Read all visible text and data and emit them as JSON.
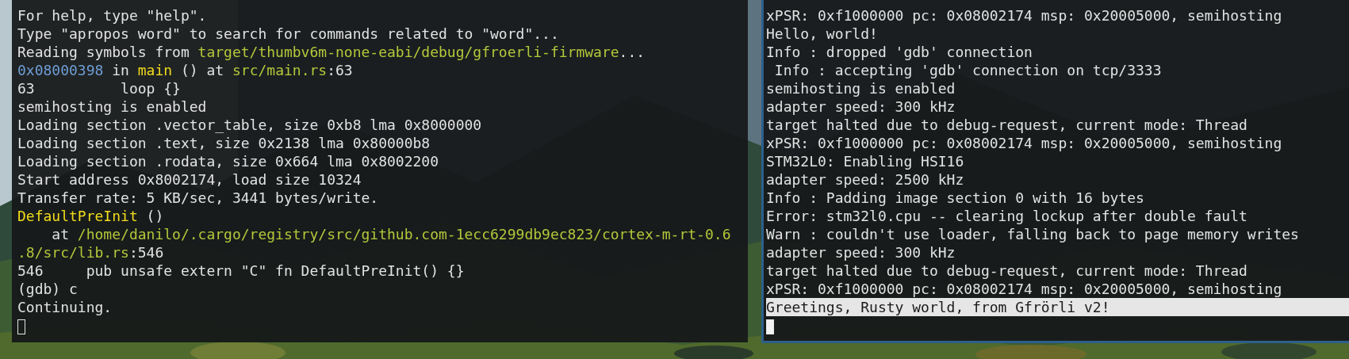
{
  "left_terminal": {
    "cursor_focused": false,
    "lines": [
      [
        {
          "kind": "plain",
          "text": "For help, type \"help\"."
        }
      ],
      [
        {
          "kind": "plain",
          "text": "Type \"apropos word\" to search for commands related to \"word\"..."
        }
      ],
      [
        {
          "kind": "plain",
          "text": "Reading symbols from "
        },
        {
          "kind": "path",
          "text": "target/thumbv6m-none-eabi/debug/gfroerli-firmware"
        },
        {
          "kind": "plain",
          "text": "..."
        }
      ],
      [
        {
          "kind": "address",
          "text": "0x08000398"
        },
        {
          "kind": "plain",
          "text": " in "
        },
        {
          "kind": "function",
          "text": "main"
        },
        {
          "kind": "plain",
          "text": " () at "
        },
        {
          "kind": "path",
          "text": "src/main.rs"
        },
        {
          "kind": "plain",
          "text": ":63"
        }
      ],
      [
        {
          "kind": "plain",
          "text": "63          loop {}"
        }
      ],
      [
        {
          "kind": "plain",
          "text": "semihosting is enabled"
        }
      ],
      [
        {
          "kind": "plain",
          "text": "Loading section .vector_table, size 0xb8 lma 0x8000000"
        }
      ],
      [
        {
          "kind": "plain",
          "text": "Loading section .text, size 0x2138 lma 0x80000b8"
        }
      ],
      [
        {
          "kind": "plain",
          "text": "Loading section .rodata, size 0x664 lma 0x8002200"
        }
      ],
      [
        {
          "kind": "plain",
          "text": "Start address 0x8002174, load size 10324"
        }
      ],
      [
        {
          "kind": "plain",
          "text": "Transfer rate: 5 KB/sec, 3441 bytes/write."
        }
      ],
      [
        {
          "kind": "function",
          "text": "DefaultPreInit"
        },
        {
          "kind": "plain",
          "text": " ()"
        }
      ],
      [
        {
          "kind": "plain",
          "text": "    at "
        },
        {
          "kind": "path",
          "text": "/home/danilo/.cargo/registry/src/github.com-1ecc6299db9ec823/cortex-m-rt-0.6"
        }
      ],
      [
        {
          "kind": "path",
          "text": ".8/src/lib.rs"
        },
        {
          "kind": "plain",
          "text": ":546"
        }
      ],
      [
        {
          "kind": "plain",
          "text": "546     pub unsafe extern \"C\" fn DefaultPreInit() {}"
        }
      ],
      [
        {
          "kind": "plain",
          "text": "(gdb) c"
        }
      ],
      [
        {
          "kind": "plain",
          "text": "Continuing."
        }
      ]
    ]
  },
  "right_terminal": {
    "cursor_focused": true,
    "lines": [
      {
        "text": "xPSR: 0xf1000000 pc: 0x08002174 msp: 0x20005000, semihosting",
        "highlighted": false
      },
      {
        "text": "Hello, world!",
        "highlighted": false
      },
      {
        "text": "Info : dropped 'gdb' connection",
        "highlighted": false
      },
      {
        "text": " Info : accepting 'gdb' connection on tcp/3333",
        "highlighted": false
      },
      {
        "text": "semihosting is enabled",
        "highlighted": false
      },
      {
        "text": "adapter speed: 300 kHz",
        "highlighted": false
      },
      {
        "text": "target halted due to debug-request, current mode: Thread",
        "highlighted": false
      },
      {
        "text": "xPSR: 0xf1000000 pc: 0x08002174 msp: 0x20005000, semihosting",
        "highlighted": false
      },
      {
        "text": "STM32L0: Enabling HSI16",
        "highlighted": false
      },
      {
        "text": "adapter speed: 2500 kHz",
        "highlighted": false
      },
      {
        "text": "Info : Padding image section 0 with 16 bytes",
        "highlighted": false
      },
      {
        "text": "Error: stm32l0.cpu -- clearing lockup after double fault",
        "highlighted": false
      },
      {
        "text": "Warn : couldn't use loader, falling back to page memory writes",
        "highlighted": false
      },
      {
        "text": "adapter speed: 300 kHz",
        "highlighted": false
      },
      {
        "text": "target halted due to debug-request, current mode: Thread",
        "highlighted": false
      },
      {
        "text": "xPSR: 0xf1000000 pc: 0x08002174 msp: 0x20005000, semihosting",
        "highlighted": false
      },
      {
        "text": "Greetings, Rusty world, from Gfrörli v2!",
        "highlighted": true
      }
    ]
  }
}
